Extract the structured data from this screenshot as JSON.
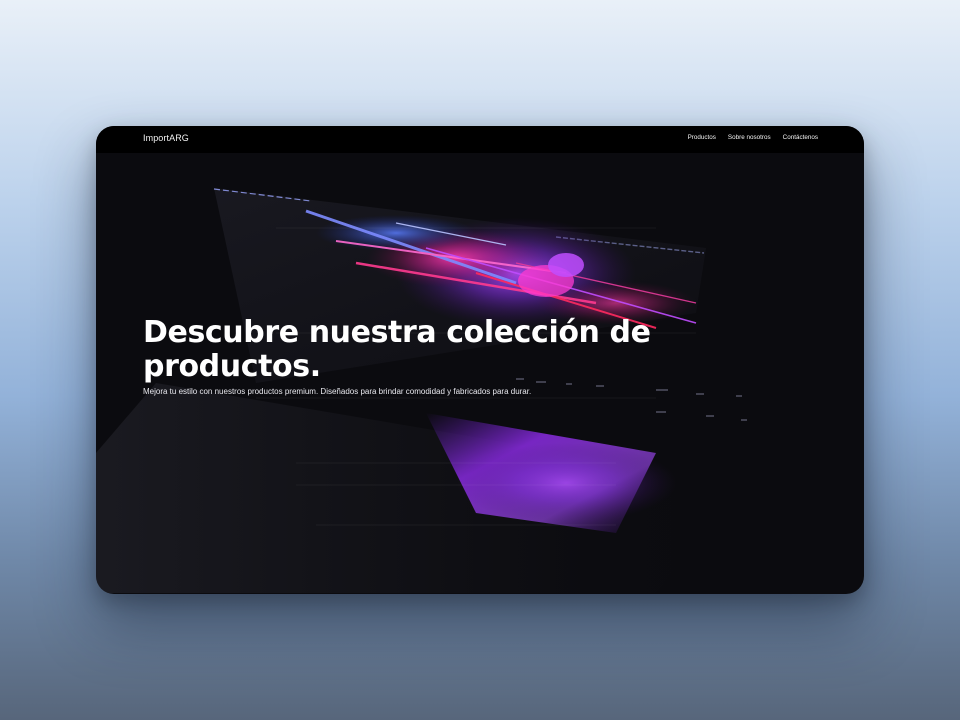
{
  "nav": {
    "brand": "ImportARG",
    "links": [
      "Productos",
      "Sobre nosotros",
      "Contáctenos"
    ]
  },
  "hero": {
    "title": "Descubre nuestra colección de productos.",
    "subtitle": "Mejora tu estilo con nuestros productos premium. Diseñados para brindar comodidad y fabricados para durar."
  },
  "colors": {
    "page_background_top": "#e9f0f8",
    "page_background_bottom": "#57667b",
    "window_background": "#0b0b0f",
    "nav_background": "#000000",
    "accent_purple": "#8a2be2",
    "accent_magenta": "#ff2fa0",
    "accent_blue": "#3a5bff"
  }
}
